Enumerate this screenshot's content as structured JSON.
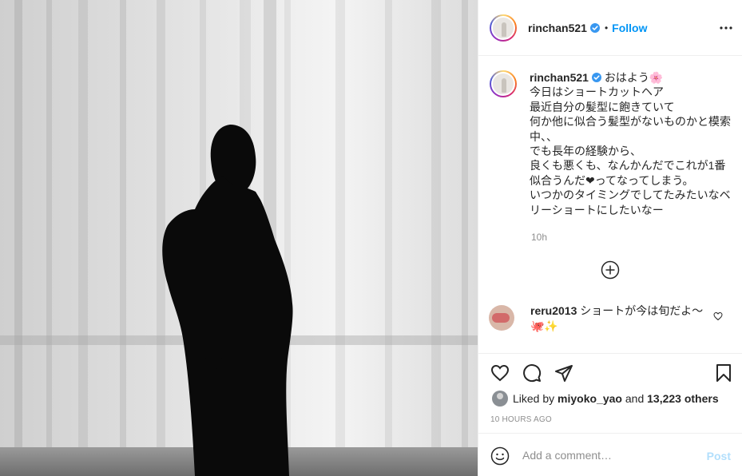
{
  "header": {
    "username": "rinchan521",
    "follow_label": "Follow",
    "separator": "•"
  },
  "caption": {
    "username": "rinchan521",
    "text": "おはよう🌸\n今日はショートカットヘア\n最近自分の髪型に飽きていて\n何か他に似合う髪型がないものかと模索中、、\nでも長年の経験から、\n良くも悪くも、なんかんだでこれが1番似合うんだ❤ってなってしまう。\nいつかのタイミングでしてたみたいなベリーショートにしたいなー",
    "time": "10h"
  },
  "comment": {
    "username": "reru2013",
    "text": "ショートが今は旬だよ〜🐙✨"
  },
  "likes": {
    "prefix": "Liked by",
    "user": "miyoko_yao",
    "middle": "and",
    "count": "13,223 others"
  },
  "timestamp": "10 HOURS AGO",
  "add_comment": {
    "placeholder": "Add a comment…",
    "post_label": "Post"
  },
  "colors": {
    "accent": "#0095f6",
    "post_disabled": "#b2dffc",
    "muted": "#8e8e8e",
    "border": "#efefef"
  },
  "icons": [
    "verified-icon",
    "more-icon",
    "add-comment-circle-icon",
    "heart-icon",
    "comment-icon",
    "share-icon",
    "bookmark-icon",
    "emoji-icon"
  ]
}
